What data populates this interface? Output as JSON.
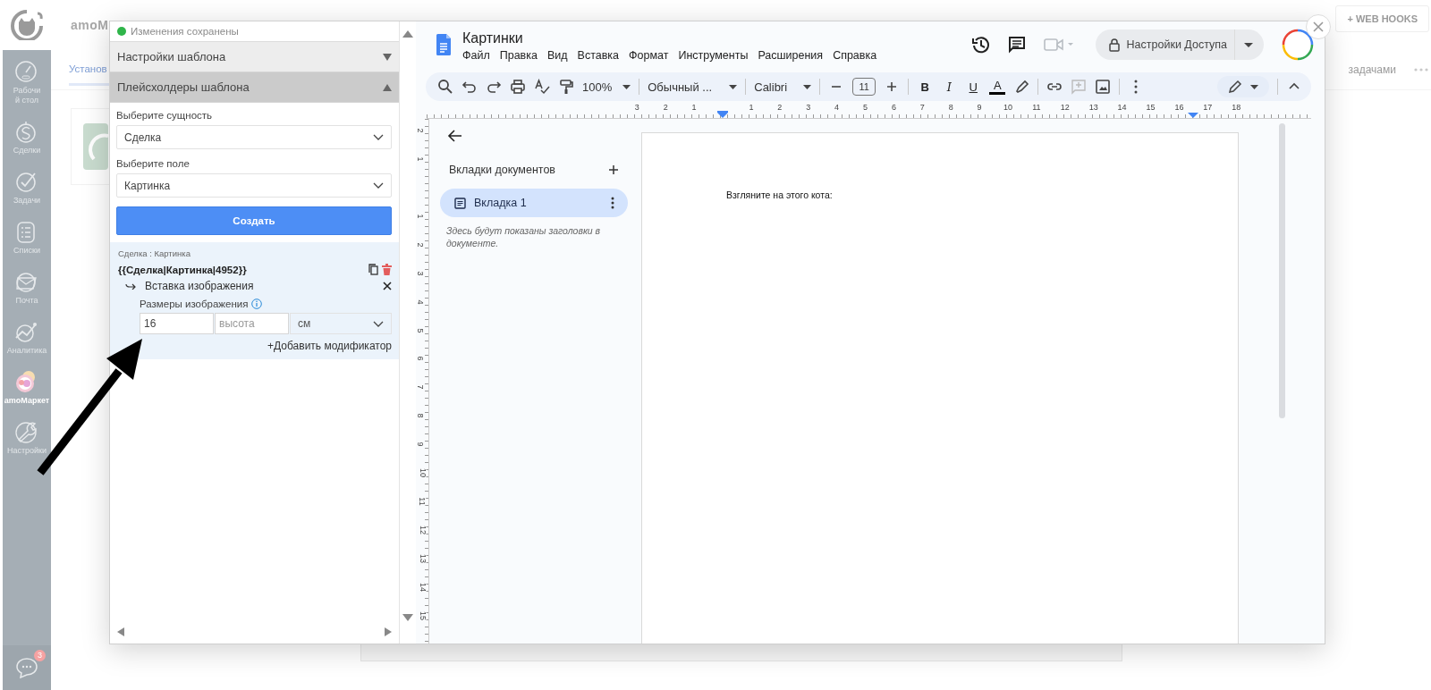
{
  "background_app": {
    "logo_text": "amoM",
    "sidebar": [
      {
        "label": "Рабочий стол",
        "kind": "dashboard",
        "selected": false
      },
      {
        "label": "Сделки",
        "kind": "deals",
        "selected": false
      },
      {
        "label": "Задачи",
        "kind": "tasks",
        "selected": false
      },
      {
        "label": "Списки",
        "kind": "lists",
        "selected": false
      },
      {
        "label": "Почта",
        "kind": "mail",
        "selected": false
      },
      {
        "label": "Аналитика",
        "kind": "analytics",
        "selected": false
      },
      {
        "label": "amoМаркет",
        "kind": "market",
        "selected": true
      },
      {
        "label": "Настройки",
        "kind": "settings",
        "selected": false
      }
    ],
    "chat_badge": "3",
    "tab": "Установ",
    "top_button": "+ WEB HOOKS",
    "right_tab": "задачами"
  },
  "plugin_panel": {
    "status": "Изменения сохранены",
    "saved": true,
    "sections": [
      {
        "title": "Настройки шаблона",
        "expanded": false
      },
      {
        "title": "Плейсхолдеры шаблона",
        "expanded": true
      }
    ],
    "entity_label": "Выберите сущность",
    "entity_value": "Сделка",
    "field_label": "Выберите поле",
    "field_value": "Картинка",
    "create_button": "Создать",
    "placeholder_card": {
      "caption": "Сделка : Картинка",
      "code": "{{Сделка|Картинка|4952}}",
      "modifier": "Вставка изображения",
      "size_label": "Размеры изображения",
      "width_value": "16",
      "height_placeholder": "высота",
      "unit": "см",
      "add_modifier": "+Добавить модификатор"
    }
  },
  "docs": {
    "title": "Картинки",
    "menu": [
      "Файл",
      "Правка",
      "Вид",
      "Вставка",
      "Формат",
      "Инструменты",
      "Расширения",
      "Справка"
    ],
    "share_button": "Настройки Доступа",
    "toolbar": {
      "zoom": "100%",
      "style": "Обычный ...",
      "font": "Calibri",
      "font_size": "11",
      "format_buttons": [
        "B",
        "I",
        "U",
        "A"
      ]
    },
    "rulers": {
      "horizontal": [
        "3",
        "2",
        "1",
        "1",
        "2",
        "3",
        "4",
        "5",
        "6",
        "7",
        "8",
        "9",
        "10",
        "11",
        "12",
        "13",
        "14",
        "15",
        "16",
        "17",
        "18"
      ],
      "vertical": [
        "2",
        "1",
        "1",
        "2",
        "3",
        "4",
        "5",
        "6",
        "7",
        "8",
        "9",
        "10",
        "11",
        "12",
        "13",
        "14",
        "15"
      ]
    },
    "tabs_panel": {
      "heading": "Вкладки документов",
      "tabs": [
        {
          "label": "Вкладка 1",
          "selected": true
        }
      ],
      "hint": "Здесь будут показаны заголовки в документе."
    },
    "page_text": "Взгляните на этого кота:"
  }
}
